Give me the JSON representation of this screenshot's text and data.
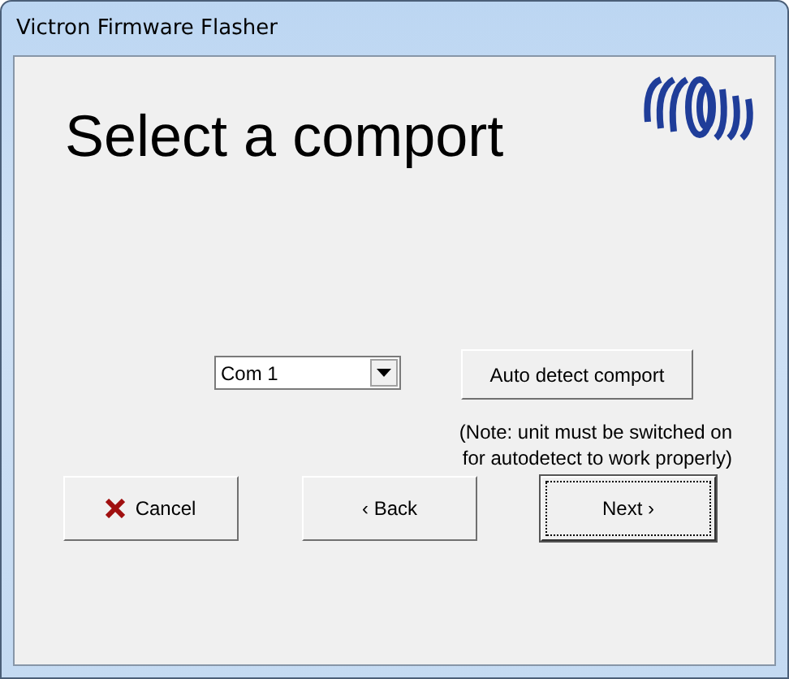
{
  "window": {
    "title": "Victron Firmware Flasher"
  },
  "heading": "Select a comport",
  "comport": {
    "value": "Com 1"
  },
  "auto_detect_button": "Auto detect comport",
  "note": "(Note: unit must be switched on for autodetect to work properly)",
  "buttons": [
    {
      "kind": "cancel",
      "label": "Cancel",
      "focused": false
    },
    {
      "kind": "back",
      "label": "‹ Back",
      "focused": false
    },
    {
      "kind": "next",
      "label": "Next ›",
      "focused": true
    }
  ]
}
